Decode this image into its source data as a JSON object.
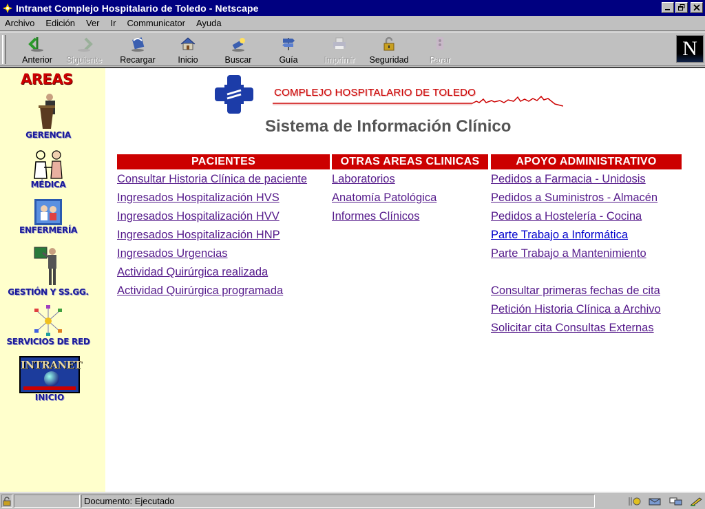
{
  "window": {
    "title": "Intranet Complejo Hospitalario de Toledo - Netscape"
  },
  "menu": [
    "Archivo",
    "Edición",
    "Ver",
    "Ir",
    "Communicator",
    "Ayuda"
  ],
  "toolbar": {
    "back": "Anterior",
    "forward": "Siguiente",
    "reload": "Recargar",
    "home": "Inicio",
    "search": "Buscar",
    "guide": "Guía",
    "print": "Imprimir",
    "security": "Seguridad",
    "stop": "Parar",
    "logo": "N"
  },
  "sidebar": {
    "title": "AREAS",
    "items": [
      {
        "label": "GERENCIA",
        "icon": "lectern-speaker-icon"
      },
      {
        "label": "MÉDICA",
        "icon": "doctors-icon"
      },
      {
        "label": "ENFERMERÍA",
        "icon": "nursing-icon"
      },
      {
        "label": "GESTIÓN Y SS.GG.",
        "icon": "presenter-board-icon"
      },
      {
        "label": "SERVICIOS DE RED",
        "icon": "network-icon"
      }
    ],
    "intranet": {
      "word": "INTRANET",
      "label": "INICIO"
    }
  },
  "header": {
    "logo_text": "COMPLEJO HOSPITALARIO DE TOLEDO",
    "title": "Sistema de Información Clínico"
  },
  "columns": {
    "pacientes": {
      "header": "PACIENTES",
      "links": [
        "Consultar Historia Clínica de paciente",
        "Ingresados Hospitalización HVS",
        "Ingresados Hospitalización HVV",
        "Ingresados Hospitalización HNP",
        "Ingresados Urgencias",
        "Actividad Quirúrgica realizada",
        "Actividad Quirúrgica programada"
      ]
    },
    "otras": {
      "header": "OTRAS AREAS CLINICAS",
      "links": [
        "Laboratorios",
        "Anatomía Patológica",
        "Informes Clínicos"
      ]
    },
    "apoyo": {
      "header": "APOYO ADMINISTRATIVO",
      "links": [
        "Pedidos a Farmacia - Unidosis",
        "Pedidos a Suministros - Almacén",
        "Pedidos a Hostelería - Cocina",
        "Parte Trabajo a Informática",
        "Parte Trabajo a Mantenimiento",
        "Consultar primeras fechas de cita",
        "Petición Historia Clínica a Archivo",
        "Solicitar cita Consultas Externas"
      ]
    }
  },
  "status": {
    "text": "Documento: Ejecutado"
  },
  "colors": {
    "accent_red": "#cc0000",
    "sidebar_bg": "#ffffcc",
    "titlebar": "#000080"
  }
}
